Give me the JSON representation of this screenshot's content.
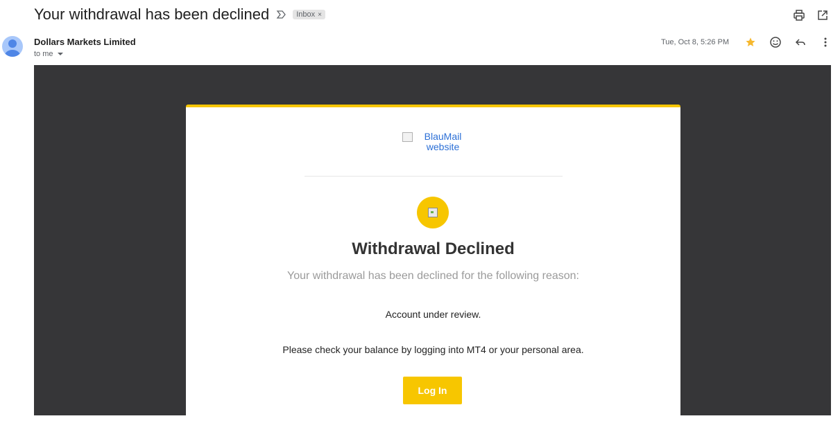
{
  "email": {
    "subject": "Your withdrawal has been declined",
    "label": "Inbox",
    "label_close": "×",
    "sender": "Dollars Markets Limited",
    "recipient": "to me",
    "date": "Tue, Oct 8, 5:26 PM"
  },
  "icons": {
    "importance": "importance-marker-icon",
    "print": "print-icon",
    "open_new_window": "open-in-new-window-icon",
    "star": "star-icon",
    "emoji": "emoji-reaction-icon",
    "reply": "reply-icon",
    "more": "more-vert-icon"
  },
  "colors": {
    "accent": "#f7c600",
    "email_background": "#363638",
    "link": "#2b6fd6"
  },
  "body": {
    "logo_alt": "BlauMail website",
    "title": "Withdrawal Declined",
    "subtitle": "Your withdrawal has been declined for the following reason:",
    "reason": "Account under review.",
    "instruction": "Please check your balance by logging into MT4 or your personal area.",
    "button_label": "Log In"
  }
}
